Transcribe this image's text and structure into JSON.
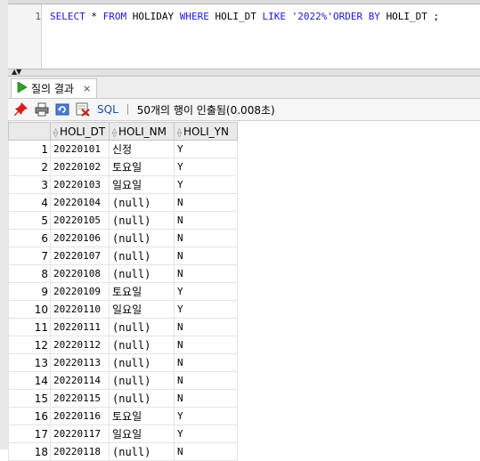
{
  "editor": {
    "line_number": "1",
    "sql": {
      "t1": "SELECT",
      "t2": "*",
      "t3": "FROM",
      "t4": "HOLIDAY",
      "t5": "WHERE",
      "t6": "HOLI_DT",
      "t7": "LIKE",
      "t8": "'2022%'",
      "t9": "ORDER BY",
      "t10": "HOLI_DT",
      "t11": ";"
    }
  },
  "results_tab": {
    "label": "질의 결과",
    "close": "×"
  },
  "toolbar": {
    "icons": [
      "pin-icon",
      "print-icon",
      "refresh-icon",
      "delete-icon"
    ],
    "sql_label": "SQL",
    "status": "50개의 행이 인출됨(0.008초)"
  },
  "grid": {
    "columns": [
      "HOLI_DT",
      "HOLI_NM",
      "HOLI_YN"
    ],
    "rows": [
      {
        "n": "1",
        "dt": "20220101",
        "nm": "신정",
        "yn": "Y"
      },
      {
        "n": "2",
        "dt": "20220102",
        "nm": "토요일",
        "yn": "Y"
      },
      {
        "n": "3",
        "dt": "20220103",
        "nm": "일요일",
        "yn": "Y"
      },
      {
        "n": "4",
        "dt": "20220104",
        "nm": "(null)",
        "yn": "N"
      },
      {
        "n": "5",
        "dt": "20220105",
        "nm": "(null)",
        "yn": "N"
      },
      {
        "n": "6",
        "dt": "20220106",
        "nm": "(null)",
        "yn": "N"
      },
      {
        "n": "7",
        "dt": "20220107",
        "nm": "(null)",
        "yn": "N"
      },
      {
        "n": "8",
        "dt": "20220108",
        "nm": "(null)",
        "yn": "N"
      },
      {
        "n": "9",
        "dt": "20220109",
        "nm": "토요일",
        "yn": "Y"
      },
      {
        "n": "10",
        "dt": "20220110",
        "nm": "일요일",
        "yn": "Y"
      },
      {
        "n": "11",
        "dt": "20220111",
        "nm": "(null)",
        "yn": "N"
      },
      {
        "n": "12",
        "dt": "20220112",
        "nm": "(null)",
        "yn": "N"
      },
      {
        "n": "13",
        "dt": "20220113",
        "nm": "(null)",
        "yn": "N"
      },
      {
        "n": "14",
        "dt": "20220114",
        "nm": "(null)",
        "yn": "N"
      },
      {
        "n": "15",
        "dt": "20220115",
        "nm": "(null)",
        "yn": "N"
      },
      {
        "n": "16",
        "dt": "20220116",
        "nm": "토요일",
        "yn": "Y"
      },
      {
        "n": "17",
        "dt": "20220117",
        "nm": "일요일",
        "yn": "Y"
      },
      {
        "n": "18",
        "dt": "20220118",
        "nm": "(null)",
        "yn": "N"
      }
    ]
  }
}
